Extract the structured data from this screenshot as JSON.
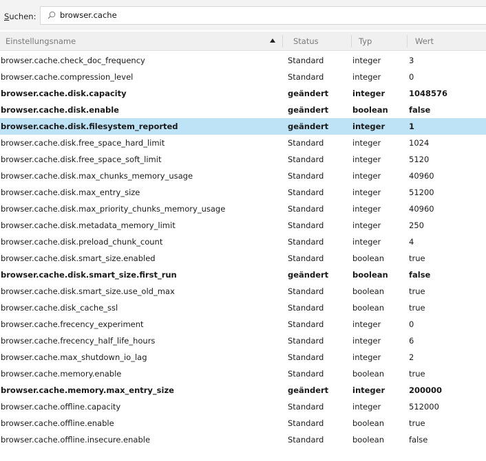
{
  "search": {
    "label_underlined": "S",
    "label_rest": "uchen:",
    "value": "browser.cache"
  },
  "header": {
    "name": "Einstellungsname",
    "status": "Status",
    "type": "Typ",
    "value": "Wert"
  },
  "rows": [
    {
      "name": "browser.cache.check_doc_frequency",
      "status": "Standard",
      "type": "integer",
      "value": "3",
      "modified": false
    },
    {
      "name": "browser.cache.compression_level",
      "status": "Standard",
      "type": "integer",
      "value": "0",
      "modified": false
    },
    {
      "name": "browser.cache.disk.capacity",
      "status": "geändert",
      "type": "integer",
      "value": "1048576",
      "modified": true
    },
    {
      "name": "browser.cache.disk.enable",
      "status": "geändert",
      "type": "boolean",
      "value": "false",
      "modified": true
    },
    {
      "name": "browser.cache.disk.filesystem_reported",
      "status": "geändert",
      "type": "integer",
      "value": "1",
      "modified": true,
      "selected": true
    },
    {
      "name": "browser.cache.disk.free_space_hard_limit",
      "status": "Standard",
      "type": "integer",
      "value": "1024",
      "modified": false
    },
    {
      "name": "browser.cache.disk.free_space_soft_limit",
      "status": "Standard",
      "type": "integer",
      "value": "5120",
      "modified": false
    },
    {
      "name": "browser.cache.disk.max_chunks_memory_usage",
      "status": "Standard",
      "type": "integer",
      "value": "40960",
      "modified": false
    },
    {
      "name": "browser.cache.disk.max_entry_size",
      "status": "Standard",
      "type": "integer",
      "value": "51200",
      "modified": false
    },
    {
      "name": "browser.cache.disk.max_priority_chunks_memory_usage",
      "status": "Standard",
      "type": "integer",
      "value": "40960",
      "modified": false
    },
    {
      "name": "browser.cache.disk.metadata_memory_limit",
      "status": "Standard",
      "type": "integer",
      "value": "250",
      "modified": false
    },
    {
      "name": "browser.cache.disk.preload_chunk_count",
      "status": "Standard",
      "type": "integer",
      "value": "4",
      "modified": false
    },
    {
      "name": "browser.cache.disk.smart_size.enabled",
      "status": "Standard",
      "type": "boolean",
      "value": "true",
      "modified": false
    },
    {
      "name": "browser.cache.disk.smart_size.first_run",
      "status": "geändert",
      "type": "boolean",
      "value": "false",
      "modified": true
    },
    {
      "name": "browser.cache.disk.smart_size.use_old_max",
      "status": "Standard",
      "type": "boolean",
      "value": "true",
      "modified": false
    },
    {
      "name": "browser.cache.disk_cache_ssl",
      "status": "Standard",
      "type": "boolean",
      "value": "true",
      "modified": false
    },
    {
      "name": "browser.cache.frecency_experiment",
      "status": "Standard",
      "type": "integer",
      "value": "0",
      "modified": false
    },
    {
      "name": "browser.cache.frecency_half_life_hours",
      "status": "Standard",
      "type": "integer",
      "value": "6",
      "modified": false
    },
    {
      "name": "browser.cache.max_shutdown_io_lag",
      "status": "Standard",
      "type": "integer",
      "value": "2",
      "modified": false
    },
    {
      "name": "browser.cache.memory.enable",
      "status": "Standard",
      "type": "boolean",
      "value": "true",
      "modified": false
    },
    {
      "name": "browser.cache.memory.max_entry_size",
      "status": "geändert",
      "type": "integer",
      "value": "200000",
      "modified": true
    },
    {
      "name": "browser.cache.offline.capacity",
      "status": "Standard",
      "type": "integer",
      "value": "512000",
      "modified": false
    },
    {
      "name": "browser.cache.offline.enable",
      "status": "Standard",
      "type": "boolean",
      "value": "true",
      "modified": false
    },
    {
      "name": "browser.cache.offline.insecure.enable",
      "status": "Standard",
      "type": "boolean",
      "value": "false",
      "modified": false
    }
  ],
  "colors": {
    "selected": "#bfe3f6",
    "header_bg": "#f0f0f0"
  }
}
